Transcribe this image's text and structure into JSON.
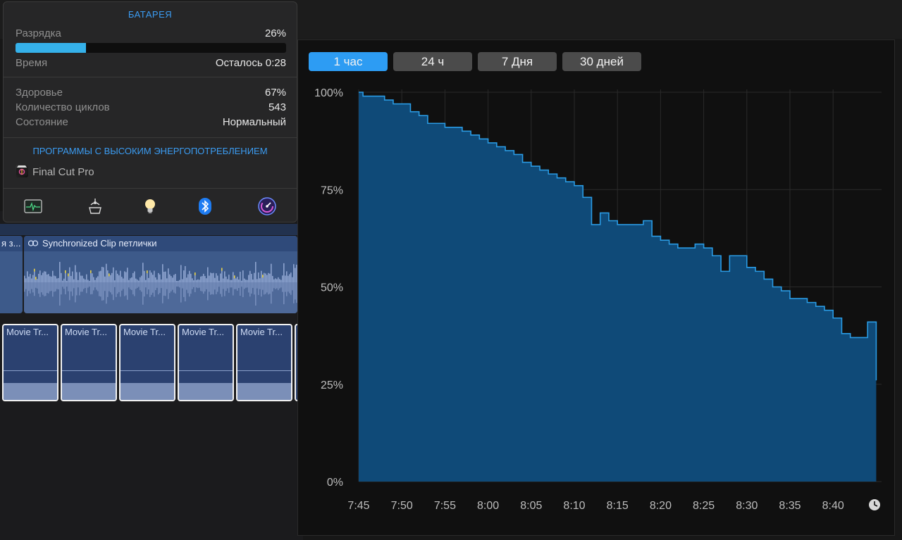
{
  "popover": {
    "title": "БАТАРЕЯ",
    "charge_label": "Разрядка",
    "charge_value": "26%",
    "charge_fraction": 0.26,
    "time_label": "Время",
    "time_value": "Осталось 0:28",
    "health_label": "Здоровье",
    "health_value": "67%",
    "cycles_label": "Количество циклов",
    "cycles_value": "543",
    "state_label": "Состояние",
    "state_value": "Нормальный",
    "high_energy_title": "ПРОГРАММЫ С ВЫСОКИМ ЭНЕРГОПОТРЕБЛЕНИЕМ",
    "apps": [
      "Final Cut Pro"
    ],
    "toolbar_icons": [
      "activity-monitor-icon",
      "network-icon",
      "lightbulb-icon",
      "bluetooth-icon",
      "istat-icon"
    ]
  },
  "timeline": {
    "sync_clip_label": "Synchronized Clip петлички",
    "left_clip_label": "я з...",
    "movie_clips": [
      "Movie Tr...",
      "Movie Tr...",
      "Movie Tr...",
      "Movie Tr...",
      "Movie Tr..."
    ]
  },
  "history": {
    "tabs": [
      "1 час",
      "24 ч",
      "7 Дня",
      "30 дней"
    ],
    "active_tab": 0
  },
  "colors": {
    "accent": "#2d9cf3",
    "chart_fill": "#0f4a78",
    "chart_line": "#2a9be4",
    "battery_bar": "#35b1ea"
  },
  "chart_data": {
    "type": "area",
    "title": "",
    "xlabel": "",
    "ylabel": "",
    "y_ticks": [
      "100%",
      "75%",
      "50%",
      "25%",
      "0%"
    ],
    "x_ticks": [
      "7:45",
      "7:50",
      "7:55",
      "8:00",
      "8:05",
      "8:10",
      "8:15",
      "8:20",
      "8:25",
      "8:30",
      "8:35",
      "8:40"
    ],
    "ylim": [
      0,
      100
    ],
    "grid": true,
    "series": [
      {
        "points": [
          [
            "7:45",
            100
          ],
          [
            "7:45:30",
            99
          ],
          [
            "7:48",
            98
          ],
          [
            "7:49",
            97
          ],
          [
            "7:51",
            95
          ],
          [
            "7:52",
            94
          ],
          [
            "7:53",
            92
          ],
          [
            "7:55",
            91
          ],
          [
            "7:57",
            90
          ],
          [
            "7:58",
            89
          ],
          [
            "7:59",
            88
          ],
          [
            "8:00",
            87
          ],
          [
            "8:01",
            86
          ],
          [
            "8:02",
            85
          ],
          [
            "8:03",
            84
          ],
          [
            "8:04",
            82
          ],
          [
            "8:05",
            81
          ],
          [
            "8:06",
            80
          ],
          [
            "8:07",
            79
          ],
          [
            "8:08",
            78
          ],
          [
            "8:09",
            77
          ],
          [
            "8:10",
            76
          ],
          [
            "8:11",
            73
          ],
          [
            "8:12",
            66
          ],
          [
            "8:13",
            69
          ],
          [
            "8:14",
            67
          ],
          [
            "8:15",
            66
          ],
          [
            "8:17",
            66
          ],
          [
            "8:18",
            67
          ],
          [
            "8:19",
            63
          ],
          [
            "8:20",
            62
          ],
          [
            "8:21",
            61
          ],
          [
            "8:22",
            60
          ],
          [
            "8:23",
            60
          ],
          [
            "8:24",
            61
          ],
          [
            "8:25",
            60
          ],
          [
            "8:26",
            58
          ],
          [
            "8:27",
            54
          ],
          [
            "8:28",
            58
          ],
          [
            "8:29",
            58
          ],
          [
            "8:30",
            55
          ],
          [
            "8:31",
            54
          ],
          [
            "8:32",
            52
          ],
          [
            "8:33",
            50
          ],
          [
            "8:34",
            49
          ],
          [
            "8:35",
            47
          ],
          [
            "8:36",
            47
          ],
          [
            "8:37",
            46
          ],
          [
            "8:38",
            45
          ],
          [
            "8:39",
            44
          ],
          [
            "8:40",
            42
          ],
          [
            "8:41",
            38
          ],
          [
            "8:42",
            37
          ],
          [
            "8:43",
            37
          ],
          [
            "8:44",
            41
          ],
          [
            "8:45",
            26
          ]
        ]
      }
    ]
  }
}
